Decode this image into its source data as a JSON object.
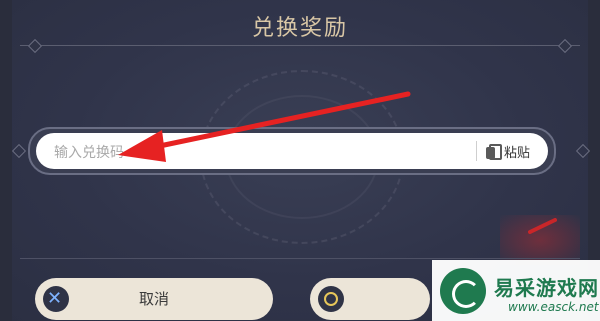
{
  "dialog": {
    "title": "兑换奖励",
    "input": {
      "placeholder": "输入兑换码",
      "paste_label": "粘贴"
    },
    "buttons": {
      "cancel_label": "取消"
    }
  },
  "watermark": {
    "site_name": "易采游戏网",
    "url": "www.easck.net"
  },
  "colors": {
    "accent": "#d9c7a6",
    "background": "#2f3346",
    "arrow": "#e62222"
  },
  "icons": [
    "paste-icon",
    "cancel-x-icon",
    "confirm-circle-icon",
    "watermark-logo-icon",
    "pointer-arrow-icon"
  ]
}
